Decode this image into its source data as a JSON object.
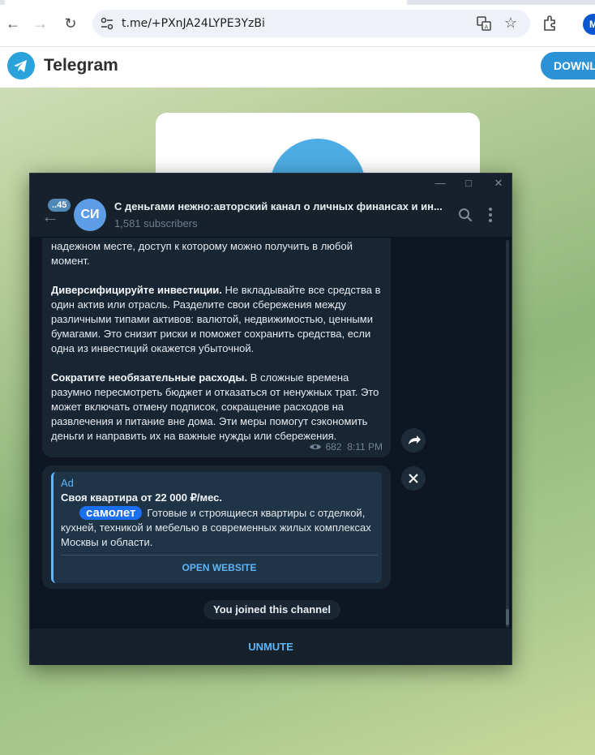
{
  "browser": {
    "url": "t.me/+PXnJA24LYPE3YzBi",
    "profile_initial": "M"
  },
  "telegram_web": {
    "brand": "Telegram",
    "download_label": "DOWNLO"
  },
  "chat_header": {
    "unread_badge": "..45",
    "avatar_initials": "СИ",
    "title": "С деньгами нежно:авторский канал о личных финансах и ин...",
    "subscribers": "1,581 subscribers"
  },
  "message": {
    "paragraphs": [
      {
        "bold": "",
        "text": "надежном месте, доступ к которому можно получить в любой момент."
      },
      {
        "bold": "Диверсифицируйте инвестиции.",
        "text": " Не вкладывайте все средства в один актив или отрасль. Разделите свои сбережения между различными типами активов: валютой, недвижимостью, ценными бумагами. Это снизит риски и поможет сохранить средства, если одна из инвестиций окажется убыточной."
      },
      {
        "bold": "Сократите необязательные расходы.",
        "text": " В сложные времена разумно пересмотреть бюджет и отказаться от ненужных трат. Это может включать отмену подписок, сокращение расходов на развлечения и питание вне дома. Эти меры помогут сэкономить деньги и направить их на важные нужды или сбережения."
      }
    ],
    "views": "682",
    "time": "8:11 PM"
  },
  "ad": {
    "label": "Ad",
    "title": "Своя квартира от 22 000 ₽/мес.",
    "brand": "самолет",
    "body": "Готовые и строящиеся квартиры с отделкой, кухней, техникой и мебелью в современных жилых комплексах Москвы и области.",
    "button": "OPEN WEBSITE"
  },
  "service_message": "You joined this channel",
  "bottom_action": "UNMUTE",
  "colors": {
    "accent": "#5eb5f7",
    "chat_bg": "#0e1621",
    "bubble": "#182533",
    "header": "#17212b",
    "telegram_blue": "#2aa3dd"
  }
}
